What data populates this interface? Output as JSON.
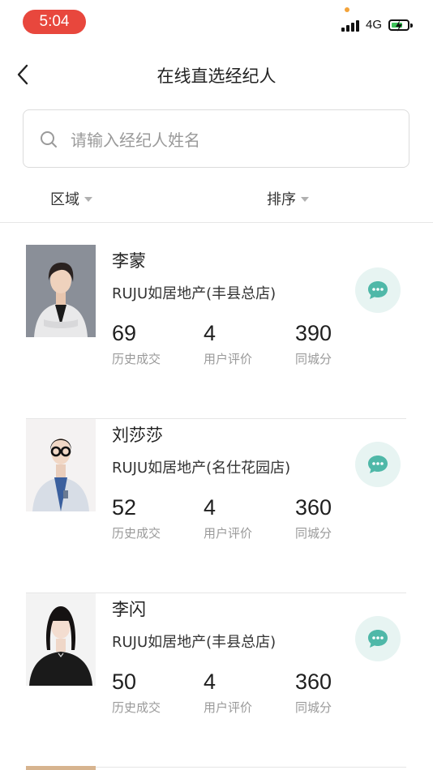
{
  "status_bar": {
    "time": "5:04",
    "network": "4G"
  },
  "nav": {
    "title": "在线直选经纪人"
  },
  "search": {
    "placeholder": "请输入经纪人姓名",
    "value": ""
  },
  "filters": {
    "area_label": "区域",
    "sort_label": "排序"
  },
  "stat_labels": {
    "deals": "历史成交",
    "reviews": "用户评价",
    "score": "同城分"
  },
  "agents": [
    {
      "name": "李蒙",
      "store": "RUJU如居地产(丰县总店)",
      "deals": "69",
      "reviews": "4",
      "score": "390"
    },
    {
      "name": "刘莎莎",
      "store": "RUJU如居地产(名仕花园店)",
      "deals": "52",
      "reviews": "4",
      "score": "360"
    },
    {
      "name": "李闪",
      "store": "RUJU如居地产(丰县总店)",
      "deals": "50",
      "reviews": "4",
      "score": "360"
    }
  ],
  "colors": {
    "accent_chat": "#4fb8a8",
    "time_pill": "#e8473d",
    "battery": "#3fc35b"
  }
}
